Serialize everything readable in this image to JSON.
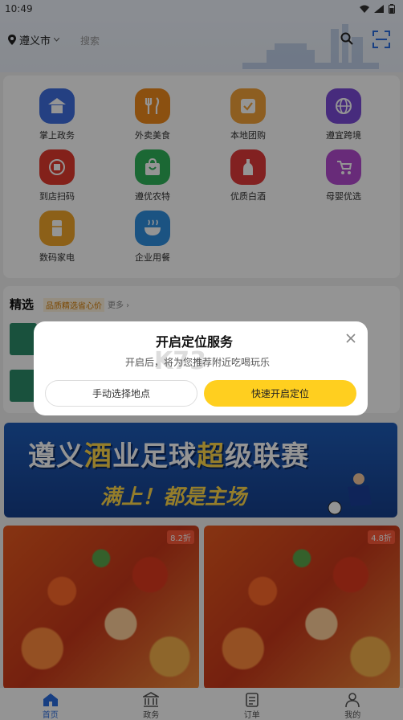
{
  "status_bar": {
    "time": "10:49"
  },
  "header": {
    "city": "遵义市",
    "search_placeholder": "搜索"
  },
  "services": [
    {
      "label": "掌上政务",
      "icon": "government-icon",
      "color": "#3f6fe0"
    },
    {
      "label": "外卖美食",
      "icon": "utensils-icon",
      "color": "#f08a1c"
    },
    {
      "label": "本地团购",
      "icon": "groupbuy-icon",
      "color": "#f3a23a"
    },
    {
      "label": "遵宜跨境",
      "icon": "globe-icon",
      "color": "#7b4ad8"
    },
    {
      "label": "到店扫码",
      "icon": "scan-pay-icon",
      "color": "#e23a2e"
    },
    {
      "label": "遵优农特",
      "icon": "shopping-bag-icon",
      "color": "#2fb45a"
    },
    {
      "label": "优质白酒",
      "icon": "liquor-bottle-icon",
      "color": "#e13a3a"
    },
    {
      "label": "母婴优选",
      "icon": "stroller-icon",
      "color": "#b44ad0"
    },
    {
      "label": "数码家电",
      "icon": "fridge-icon",
      "color": "#f2a62a"
    },
    {
      "label": "企业用餐",
      "icon": "bowl-icon",
      "color": "#2f8fe0"
    }
  ],
  "featured": {
    "title": "精选",
    "tag": "品质精选省心价",
    "more": "更多 ›"
  },
  "banner": {
    "title_a": "遵义",
    "title_b": "酒",
    "title_c": "业足球",
    "title_d": "超",
    "title_e": "级联赛",
    "subtitle": "满上！都是主场"
  },
  "food_cards": [
    {
      "discount": "8.2折"
    },
    {
      "discount": "4.8折"
    }
  ],
  "dialog": {
    "title": "开启定位服务",
    "body": "开启后，将为您推荐附近吃喝玩乐",
    "manual_button": "手动选择地点",
    "quick_button": "快速开启定位"
  },
  "tabs": [
    {
      "label": "首页",
      "icon": "home-icon",
      "active": true
    },
    {
      "label": "政务",
      "icon": "government-building-icon",
      "active": false
    },
    {
      "label": "订单",
      "icon": "order-list-icon",
      "active": false
    },
    {
      "label": "我的",
      "icon": "user-icon",
      "active": false
    }
  ]
}
